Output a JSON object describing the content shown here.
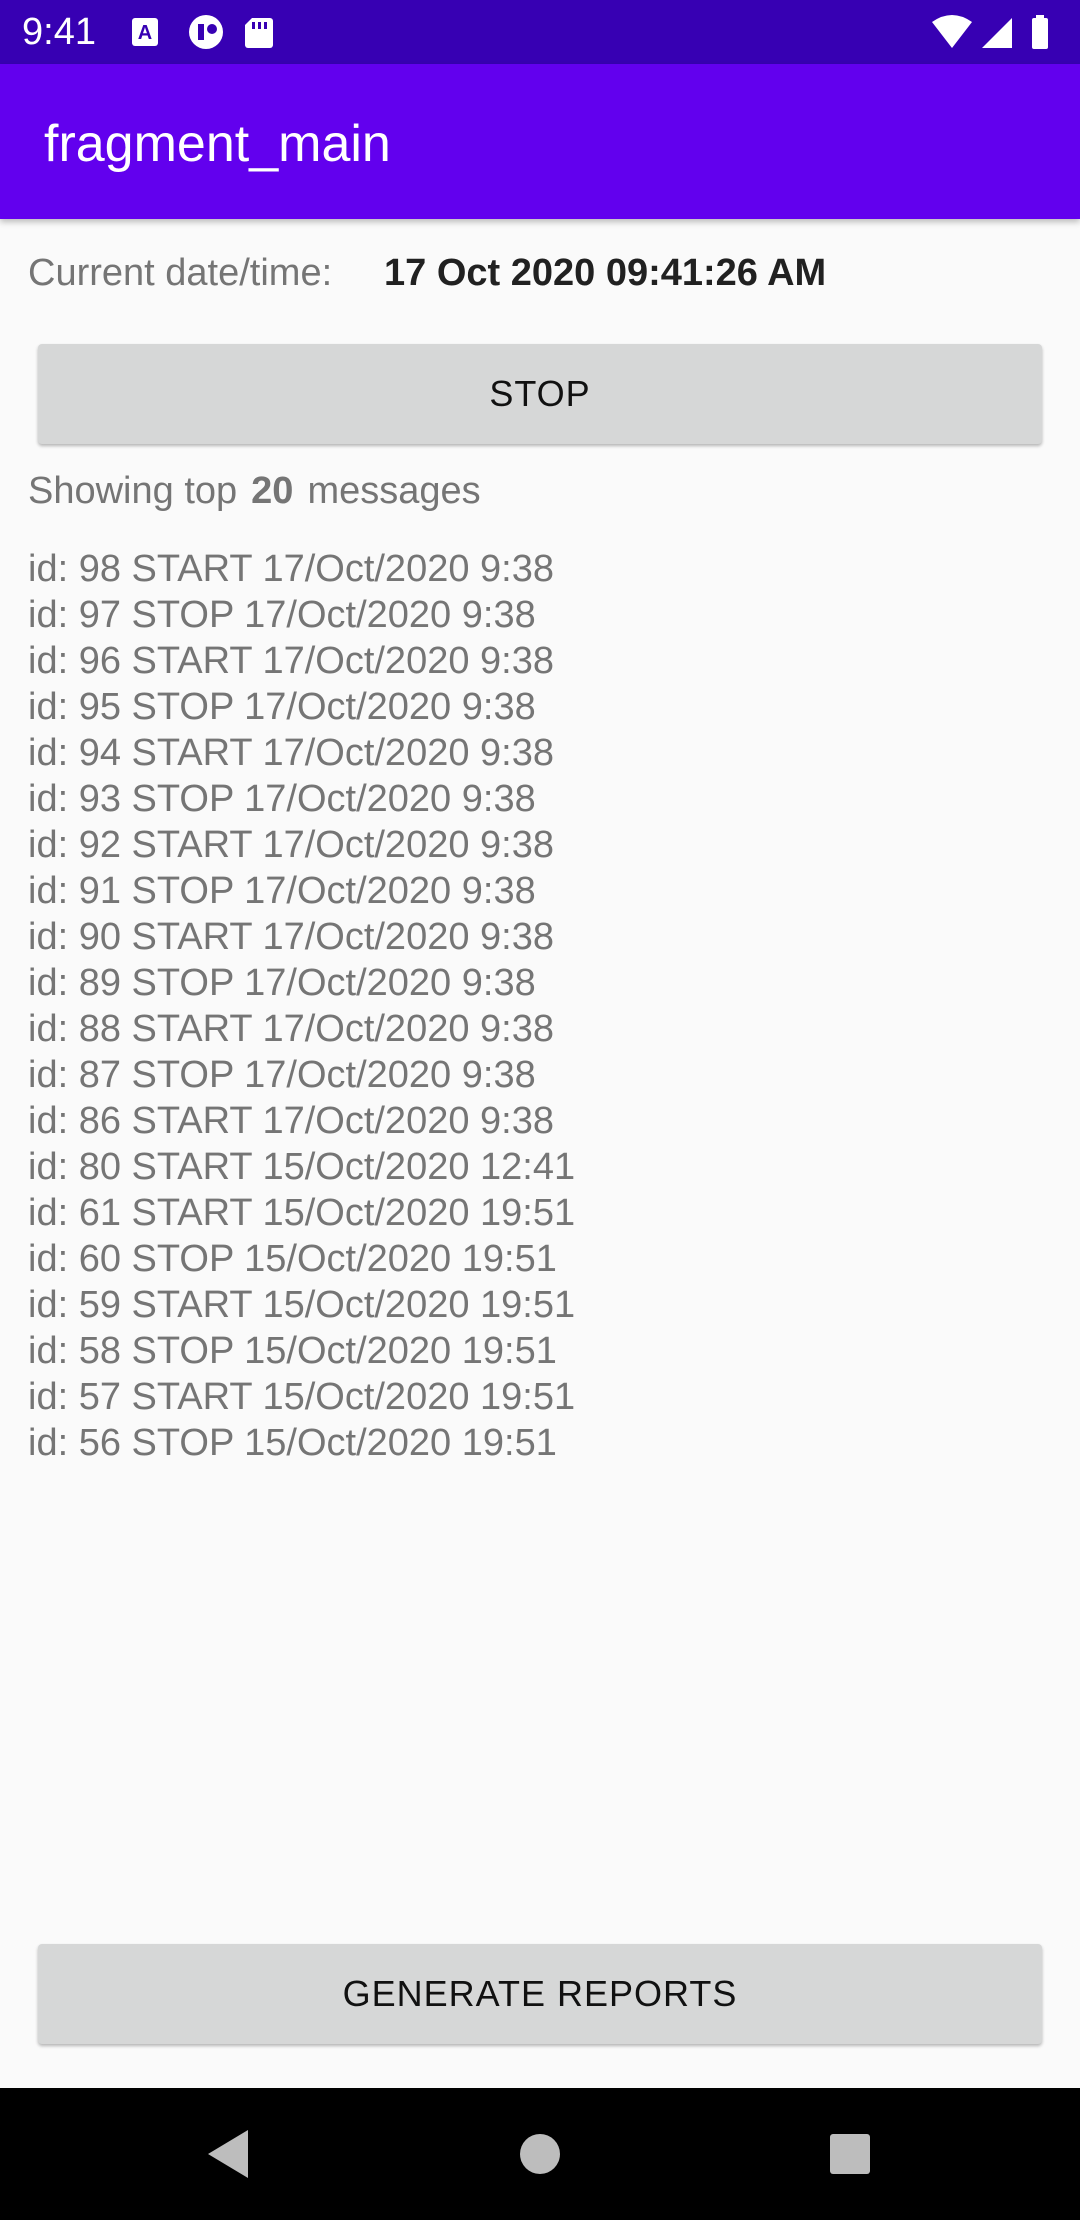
{
  "status_bar": {
    "time": "9:41",
    "left_icons": [
      "a-notification-icon",
      "circle-notification-icon",
      "sd-card-icon"
    ],
    "right_icons": [
      "wifi-icon",
      "signal-icon",
      "battery-icon"
    ]
  },
  "app_bar": {
    "title": "fragment_main",
    "color": "#6200ee",
    "status_color": "#3700b3"
  },
  "datetime": {
    "label": "Current date/time:",
    "value": "17 Oct 2020 09:41:26 AM"
  },
  "stop_button": {
    "label": "STOP"
  },
  "showing": {
    "prefix": "Showing top",
    "count": "20",
    "suffix": "messages"
  },
  "messages": [
    "id: 98 START 17/Oct/2020 9:38",
    "id: 97 STOP 17/Oct/2020 9:38",
    "id: 96 START 17/Oct/2020 9:38",
    "id: 95 STOP 17/Oct/2020 9:38",
    "id: 94 START 17/Oct/2020 9:38",
    "id: 93 STOP 17/Oct/2020 9:38",
    "id: 92 START 17/Oct/2020 9:38",
    "id: 91 STOP 17/Oct/2020 9:38",
    "id: 90 START 17/Oct/2020 9:38",
    "id: 89 STOP 17/Oct/2020 9:38",
    "id: 88 START 17/Oct/2020 9:38",
    "id: 87 STOP 17/Oct/2020 9:38",
    "id: 86 START 17/Oct/2020 9:38",
    "id: 80 START 15/Oct/2020 12:41",
    "id: 61 START 15/Oct/2020 19:51",
    "id: 60 STOP 15/Oct/2020 19:51",
    "id: 59 START 15/Oct/2020 19:51",
    "id: 58 STOP 15/Oct/2020 19:51",
    "id: 57 START 15/Oct/2020 19:51",
    "id: 56 STOP 15/Oct/2020 19:51"
  ],
  "generate_button": {
    "label": "GENERATE REPORTS"
  },
  "nav_bar": {
    "icons": [
      "back-icon",
      "home-icon",
      "recents-icon"
    ]
  }
}
